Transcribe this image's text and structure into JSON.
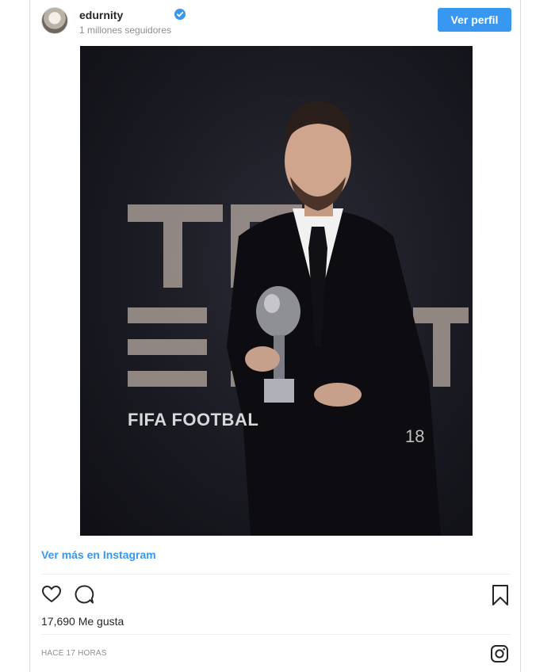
{
  "post": {
    "username": "edurnity",
    "followers": "1 millones seguidores",
    "profile_button": "Ver perfil",
    "photo_text": "FIFA FOOTBAL",
    "photo_year": "18",
    "view_more": "Ver más en Instagram",
    "likes": "17,690 Me gusta",
    "timestamp": "HACE 17 HORAS"
  },
  "icons": {
    "verified": "verified-badge-icon",
    "heart": "heart-icon",
    "comment": "comment-icon",
    "bookmark": "bookmark-icon",
    "instagram": "instagram-logo-icon"
  },
  "colors": {
    "accent": "#3897f0",
    "text": "#262626",
    "muted": "#8e8e8e"
  }
}
